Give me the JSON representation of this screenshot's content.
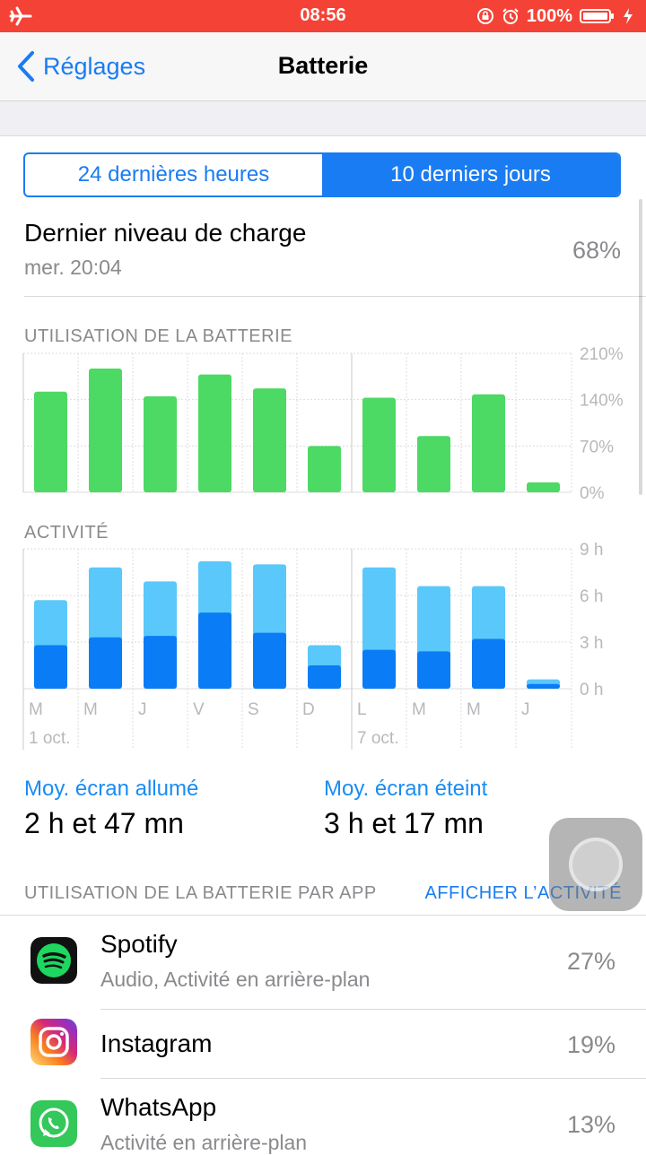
{
  "status_bar": {
    "time": "08:56",
    "battery_percent": "100%",
    "icons": [
      "airplane-icon",
      "orientation-lock-icon",
      "alarm-icon",
      "battery-icon",
      "charging-icon"
    ]
  },
  "nav": {
    "back_label": "Réglages",
    "title": "Batterie"
  },
  "segments": [
    {
      "label": "24 dernières heures",
      "selected": false
    },
    {
      "label": "10 derniers jours",
      "selected": true
    }
  ],
  "last_charge": {
    "title": "Dernier niveau de charge",
    "time": "mer. 20:04",
    "value": "68%"
  },
  "battery_chart_heading": "UTILISATION DE LA BATTERIE",
  "activity_chart_heading": "ACTIVITÉ",
  "day_labels": [
    "M",
    "M",
    "J",
    "V",
    "S",
    "D",
    "L",
    "M",
    "M",
    "J"
  ],
  "date_labels": [
    "1 oct.",
    "7 oct."
  ],
  "chart_data": [
    {
      "type": "bar",
      "title": "UTILISATION DE LA BATTERIE",
      "categories": [
        "M",
        "M",
        "J",
        "V",
        "S",
        "D",
        "L",
        "M",
        "M",
        "J"
      ],
      "values": [
        152,
        187,
        145,
        178,
        157,
        70,
        143,
        85,
        148,
        15
      ],
      "ylim": [
        0,
        210
      ],
      "yticks": [
        "0%",
        "70%",
        "140%",
        "210%"
      ],
      "color": "#4cd964"
    },
    {
      "type": "bar",
      "title": "ACTIVITÉ",
      "categories": [
        "M",
        "M",
        "J",
        "V",
        "S",
        "D",
        "L",
        "M",
        "M",
        "J"
      ],
      "series": [
        {
          "values": [
            2.8,
            3.3,
            3.4,
            4.9,
            3.6,
            1.5,
            2.5,
            2.4,
            3.2,
            0.3
          ],
          "color": "#0a7cf5"
        },
        {
          "values": [
            5.7,
            7.8,
            6.9,
            8.2,
            8.0,
            2.8,
            7.8,
            6.6,
            6.6,
            0.6
          ],
          "color": "#5ac8fa"
        }
      ],
      "ylim": [
        0,
        9
      ],
      "yticks": [
        "0 h",
        "3 h",
        "6 h",
        "9 h"
      ]
    }
  ],
  "averages": {
    "screen_on_label": "Moy. écran allumé",
    "screen_on_value": "2 h et 47 mn",
    "screen_off_label": "Moy. écran éteint",
    "screen_off_value": "3 h et 17 mn"
  },
  "apps_section": {
    "heading": "UTILISATION DE LA BATTERIE PAR APP",
    "action": "AFFICHER L’ACTIVITÉ"
  },
  "apps": [
    {
      "name": "Spotify",
      "sub": "Audio, Activité en arrière-plan",
      "pct": "27%",
      "icon": "spotify-icon"
    },
    {
      "name": "Instagram",
      "sub": "",
      "pct": "19%",
      "icon": "instagram-icon"
    },
    {
      "name": "WhatsApp",
      "sub": "Activité en arrière-plan",
      "pct": "13%",
      "icon": "whatsapp-icon"
    }
  ]
}
